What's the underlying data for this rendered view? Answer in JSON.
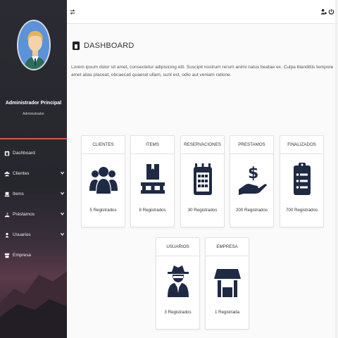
{
  "sidebar": {
    "profile_name": "Administrador Principal",
    "profile_role": "Administrador",
    "items": [
      {
        "label": "Dashboard",
        "icon": "dashboard-icon",
        "has_submenu": false
      },
      {
        "label": "Clientes",
        "icon": "users-icon",
        "has_submenu": true
      },
      {
        "label": "Items",
        "icon": "items-icon",
        "has_submenu": true
      },
      {
        "label": "Préstamos",
        "icon": "loan-icon",
        "has_submenu": true
      },
      {
        "label": "Usuarios",
        "icon": "user-icon",
        "has_submenu": true
      },
      {
        "label": "Empresa",
        "icon": "store-icon",
        "has_submenu": false
      }
    ]
  },
  "topbar": {
    "toggle_icon": "toggle-icon",
    "user_icon": "user-settings-icon",
    "power_icon": "power-icon"
  },
  "main": {
    "title": "DASHBOARD",
    "intro": "Lorem ipsum dolor sit amet, consectetur adipisicing elit. Suscipit nostrum rerum animi natus beatae ex. Culpa blanditiis tempore amet alias placeat, obcaecati quaerat ullam, sunt est, odio aut veniam ratione.",
    "cards": [
      {
        "title": "CLIENTES",
        "count": "5 Registrados",
        "icon": "users-icon"
      },
      {
        "title": "ITEMS",
        "count": "9 Registrados",
        "icon": "pallet-icon"
      },
      {
        "title": "RESERVACIONES",
        "count": "30 Registrados",
        "icon": "calendar-icon"
      },
      {
        "title": "PRESTAMOS",
        "count": "200 Registrados",
        "icon": "hand-dollar-icon"
      },
      {
        "title": "FINALIZADOS",
        "count": "700 Registrados",
        "icon": "clipboard-list-icon"
      },
      {
        "title": "USUARIOS",
        "count": "3 Registrados",
        "icon": "user-secret-icon"
      },
      {
        "title": "EMPRESA",
        "count": "1 Registrada",
        "icon": "store-icon"
      }
    ]
  },
  "colors": {
    "sidebar_bg": "#26262d",
    "accent_line": "#e0534f",
    "icon_navy": "#1f2a44"
  }
}
